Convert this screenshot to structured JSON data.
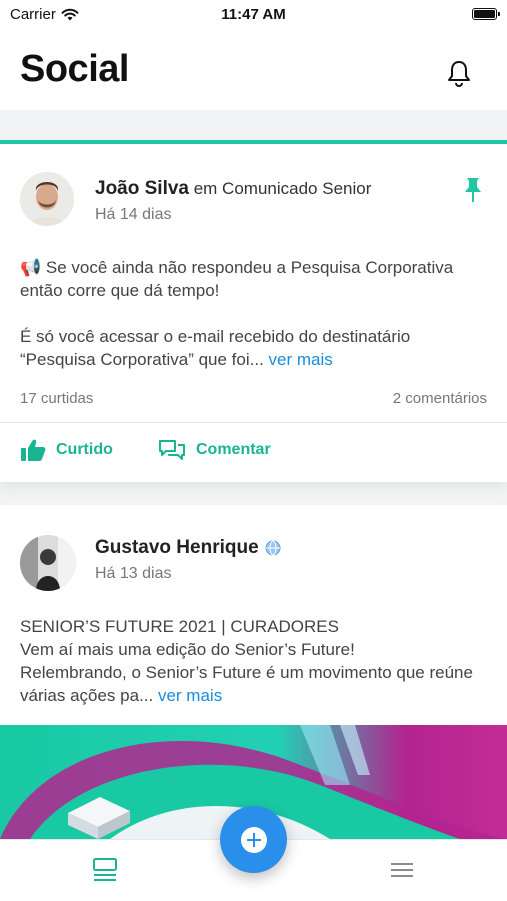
{
  "status_bar": {
    "carrier": "Carrier",
    "time": "11:47 AM"
  },
  "header": {
    "title": "Social"
  },
  "posts": [
    {
      "author": "João Silva",
      "context": " em Comunicado Senior",
      "date": "Há 14 dias",
      "pinned": true,
      "paragraphs": [
        "📢 Se você ainda não respondeu a Pesquisa Corporativa então corre que dá tempo!",
        "É só você acessar o e-mail recebido do destinatário “Pesquisa Corporativa” que foi... "
      ],
      "see_more": "ver mais",
      "likes": "17 curtidas",
      "comments": "2 comentários",
      "like_action": "Curtido",
      "comment_action": "Comentar"
    },
    {
      "author": "Gustavo Henrique",
      "context": "",
      "date": "Há 13 dias",
      "paragraphs": [
        "SENIOR’S FUTURE 2021 | CURADORES",
        "Vem aí mais uma edição do Senior’s Future!",
        "Relembrando, o Senior’s Future é um movimento que reúne várias ações pa... "
      ],
      "see_more": "ver mais"
    }
  ],
  "colors": {
    "accent": "#1fc8a3",
    "link": "#1a8ce0",
    "fab": "#2a8fea",
    "banner_teal": "#19c9a3",
    "banner_magenta": "#b3248f"
  },
  "tab_bar": {
    "items": [
      "feed-icon",
      "add-icon",
      "menu-icon"
    ]
  }
}
